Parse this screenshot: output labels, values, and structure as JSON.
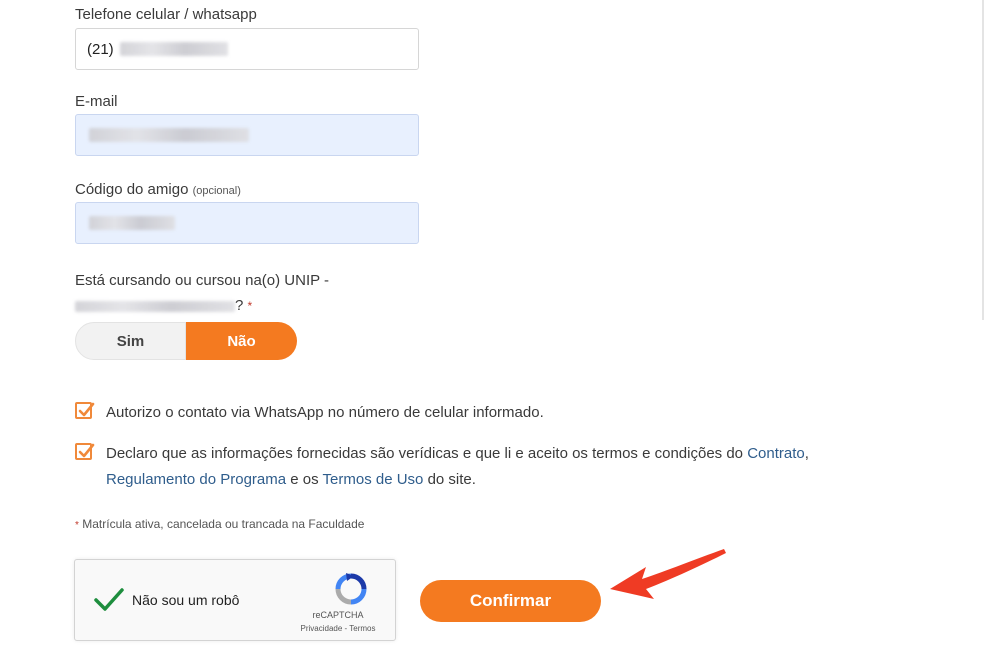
{
  "phone": {
    "label": "Telefone celular / whatsapp",
    "prefix": "(21)"
  },
  "email": {
    "label": "E-mail"
  },
  "friend_code": {
    "label": "Código do amigo",
    "note": "(opcional)"
  },
  "question": {
    "line1": "Está cursando ou cursou na(o) UNIP -",
    "suffix": "?",
    "star": "*"
  },
  "toggle": {
    "yes": "Sim",
    "no": "Não",
    "selected": "Não"
  },
  "consents": {
    "whatsapp": "Autorizo o contato via WhatsApp no número de celular informado.",
    "terms_part1": "Declaro que as informações fornecidas são verídicas e que li e aceito os termos e condições do ",
    "contract_link": "Contrato",
    "terms_part2": ",",
    "regulation_link": "Regulamento do Programa",
    "terms_part3": " e os ",
    "terms_link": "Termos de Uso",
    "terms_part4": " do site."
  },
  "footnote": {
    "star": "*",
    "text": "Matrícula ativa, cancelada ou trancada na Faculdade"
  },
  "recaptcha": {
    "label": "Não sou um robô",
    "brand": "reCAPTCHA",
    "links": "Privacidade - Termos"
  },
  "confirm_button": "Confirmar",
  "colors": {
    "accent": "#f47a20",
    "link": "#2f5d8c",
    "arrow": "#ef3b24",
    "check": "#1e8e3e"
  }
}
